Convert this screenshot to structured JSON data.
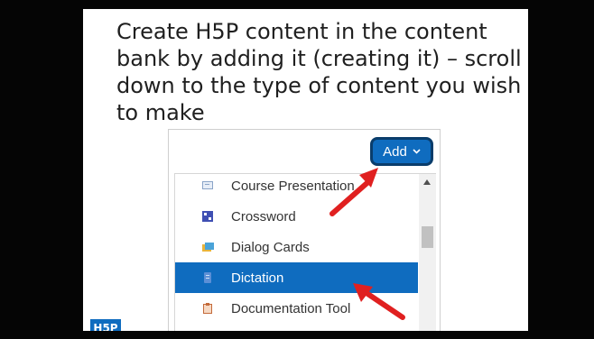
{
  "slide": {
    "lines": [
      "Create H5P content in the content",
      "bank by adding it (creating it) – scroll",
      "down to the type of content you wish",
      "to make"
    ],
    "logo_text": "H5P"
  },
  "add_button": {
    "label": "Add",
    "chevron": "⌄"
  },
  "menu": {
    "items": [
      {
        "label": "Course Presentation",
        "icon": "course-presentation-icon"
      },
      {
        "label": "Crossword",
        "icon": "crossword-icon"
      },
      {
        "label": "Dialog Cards",
        "icon": "dialog-cards-icon"
      },
      {
        "label": "Dictation",
        "icon": "dictation-icon",
        "selected": true
      },
      {
        "label": "Documentation Tool",
        "icon": "documentation-tool-icon"
      }
    ]
  },
  "colors": {
    "accent": "#0f6cbf",
    "arrow": "#e02020"
  }
}
